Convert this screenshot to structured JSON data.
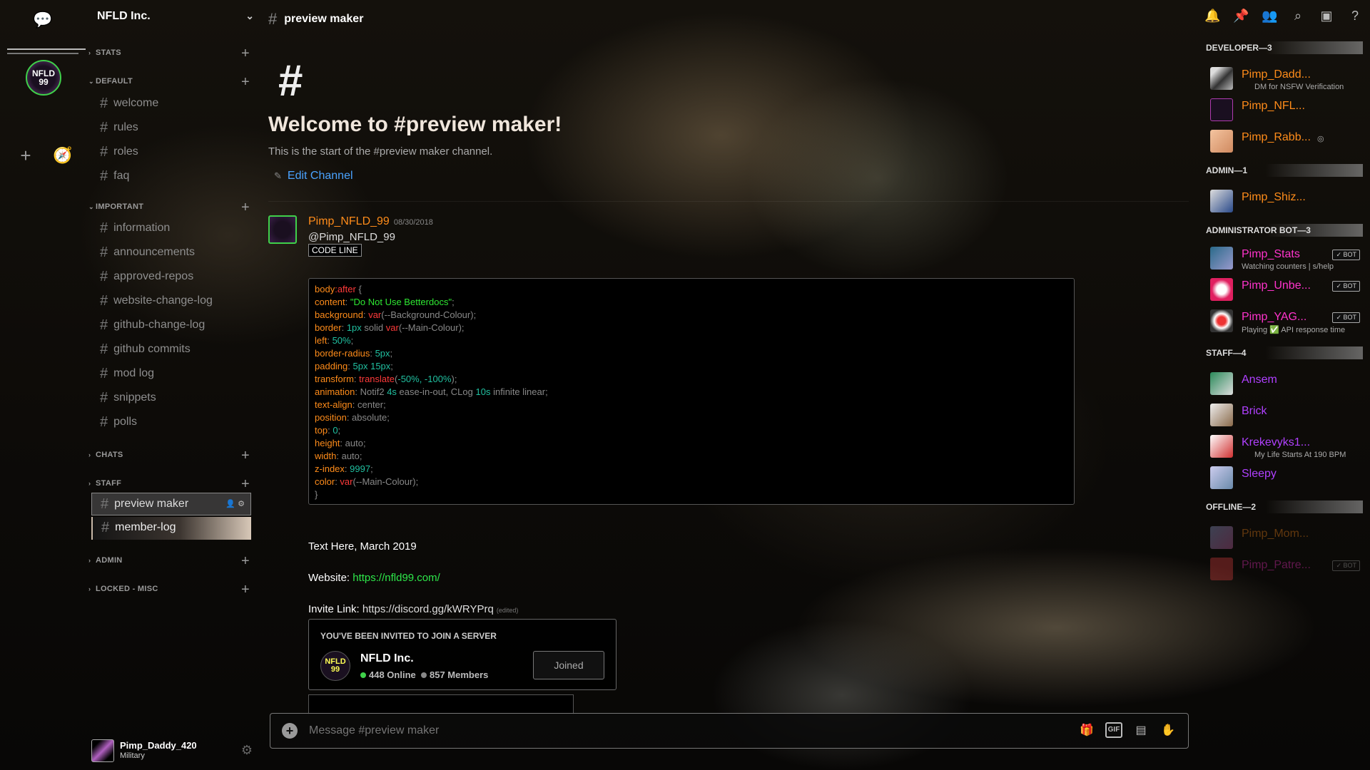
{
  "server": {
    "name": "NFLD Inc.",
    "icon_text": "NFLD 99"
  },
  "sidebar": {
    "categories": {
      "stats": "STATS",
      "default": "DEFAULT",
      "important": "IMPORTANT",
      "chats": "CHATS",
      "staff": "STAFF",
      "admin": "ADMIN",
      "locked": "LOCKED - MISC"
    },
    "channels": {
      "welcome": "welcome",
      "rules": "rules",
      "roles": "roles",
      "faq": "faq",
      "information": "information",
      "announcements": "announcements",
      "approved_repos": "approved-repos",
      "website_change_log": "website-change-log",
      "github_change_log": "github-change-log",
      "github_commits": "github commits",
      "mod_log": "mod log",
      "snippets": "snippets",
      "polls": "polls",
      "preview_maker": "preview maker",
      "member_log": "member-log"
    }
  },
  "user": {
    "name": "Pimp_Daddy_420",
    "status": "Military"
  },
  "topbar": {
    "channel_name": "preview maker"
  },
  "chat": {
    "welcome_title": "Welcome to #preview maker!",
    "welcome_sub": "This is the start of the #preview maker channel.",
    "edit_channel": "Edit Channel",
    "message": {
      "author": "Pimp_NFLD_99",
      "timestamp": "08/30/2018",
      "mention": "@Pimp_NFLD_99",
      "code_tag": "CODE LINE"
    },
    "lines": {
      "text_here": "Text Here, March 2019",
      "website_label": "Website: ",
      "website_url": "https://nfld99.com/",
      "invite_label": "Invite Link: ",
      "invite_url": "https://discord.gg/kWRYPrq",
      "edited": "(edited)"
    },
    "invite": {
      "heading": "YOU'VE BEEN INVITED TO JOIN A SERVER",
      "server": "NFLD Inc.",
      "online": "448 Online",
      "members": "857 Members",
      "button": "Joined"
    },
    "composer_placeholder": "Message #preview maker"
  },
  "code": {
    "l1_sel": "body",
    "l1_pseudo": ":after",
    "l1_brace": " {",
    "l2_p": "content",
    "l2_v": "\"Do Not Use Betterdocs\"",
    "l3_p": "background",
    "l3_f": "var",
    "l3_a": "(--Background-Colour);",
    "l4_p": "border",
    "l4_n": "1px",
    "l4_u": " solid ",
    "l4_f": "var",
    "l4_a": "(--Main-Colour);",
    "l5_p": "left",
    "l5_n": "50%",
    "l6_p": "border-radius",
    "l6_n": "5px",
    "l7_p": "padding",
    "l7_n": "5px 15px",
    "l8_p": "transform",
    "l8_f": "translate",
    "l8_a1": "(",
    "l8_n": "-50%, -100%",
    "l8_a2": ");",
    "l9_p": "animation",
    "l9_u1": " Notif2 ",
    "l9_n1": "4s",
    "l9_u2": " ease-in-out, CLog ",
    "l9_n2": "10s",
    "l9_u3": " infinite linear;",
    "l10_p": "text-align",
    "l10_u": " center;",
    "l11_p": "position",
    "l11_u": " absolute;",
    "l12_p": "top",
    "l12_n": "0",
    "l13_p": "height",
    "l13_u": " auto;",
    "l14_p": "width",
    "l14_u": " auto;",
    "l15_p": "z-index",
    "l15_n": "9997",
    "l16_p": "color",
    "l16_f": "var",
    "l16_a": "(--Main-Colour);",
    "l17": "}"
  },
  "members": {
    "roles": {
      "developer": "DEVELOPER—3",
      "admin": "ADMIN—1",
      "admin_bot": "ADMINISTRATOR BOT—3",
      "staff": "STAFF—4",
      "offline": "OFFLINE—2"
    },
    "list": {
      "m1": {
        "name": "Pimp_Dadd...",
        "status": "DM for NSFW Verification"
      },
      "m2": {
        "name": "Pimp_NFL..."
      },
      "m3": {
        "name": "Pimp_Rabb..."
      },
      "m4": {
        "name": "Pimp_Shiz..."
      },
      "m5": {
        "name": "Pimp_Stats",
        "status": "Watching counters | s/help",
        "badge": "✓ BOT"
      },
      "m6": {
        "name": "Pimp_Unbe...",
        "badge": "✓ BOT"
      },
      "m7": {
        "name": "Pimp_YAG...",
        "status": "Playing ✅ API response time",
        "badge": "✓ BOT"
      },
      "m8": {
        "name": "Ansem"
      },
      "m9": {
        "name": "Brick"
      },
      "m10": {
        "name": "Krekevyks1...",
        "status": "My Life Starts At 190 BPM"
      },
      "m11": {
        "name": "Sleepy"
      },
      "m12": {
        "name": "Pimp_Mom..."
      },
      "m13": {
        "name": "Pimp_Patre...",
        "badge": "✓ BOT"
      }
    }
  },
  "colors": {
    "developer": "#ff8c1a",
    "admin": "#ff8c1a",
    "bot": "#ff33cc",
    "staff": "#b040ff",
    "link": "#4aa3ff",
    "accent_green": "#2ee832"
  }
}
